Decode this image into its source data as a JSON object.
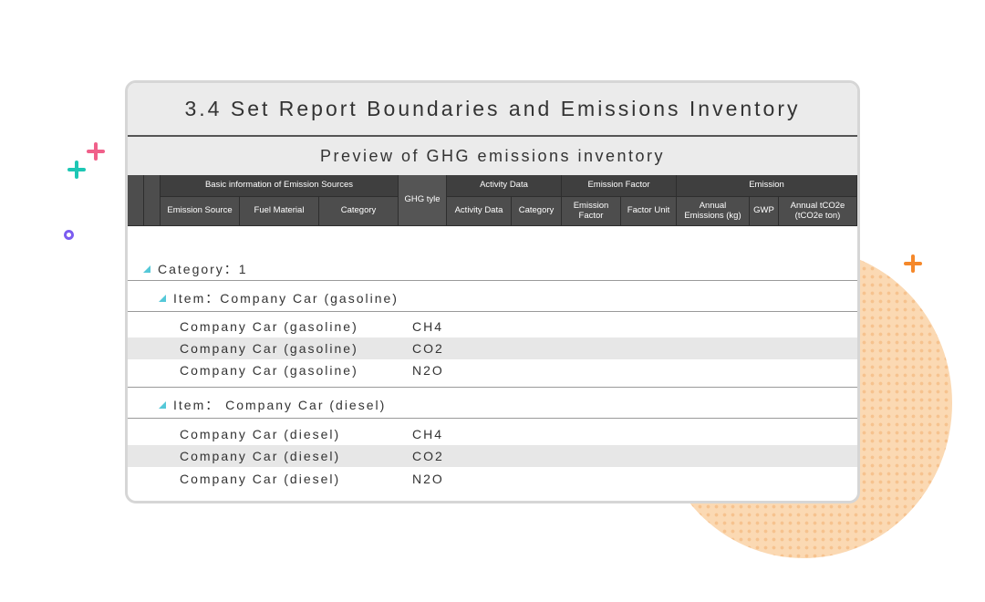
{
  "card": {
    "title": "3.4 Set Report Boundaries and Emissions Inventory",
    "subtitle": "Preview of GHG emissions inventory"
  },
  "header": {
    "groups": {
      "basic_info": "Basic information of Emission Sources",
      "ghg_type": "GHG tyle",
      "activity_data": "Activity Data",
      "emission_factor": "Emission Factor",
      "emission": "Emission"
    },
    "columns": {
      "emission_source": "Emission Source",
      "fuel_material": "Fuel Material",
      "category": "Category",
      "activity_data": "Activity Data",
      "activity_category": "Category",
      "emission_factor": "Emission Factor",
      "factor_unit": "Factor Unit",
      "annual_emissions_kg": "Annual Emissions (kg)",
      "gwp": "GWP",
      "annual_tco2e": "Annual tCO2e (tCO2e ton)"
    }
  },
  "inventory": {
    "category_label": "Category：1",
    "items": [
      {
        "label": "Item：Company Car (gasoline)",
        "rows": [
          {
            "source": "Company Car (gasoline)",
            "ghg": "CH4"
          },
          {
            "source": "Company Car (gasoline)",
            "ghg": "CO2"
          },
          {
            "source": "Company Car (gasoline)",
            "ghg": "N2O"
          }
        ]
      },
      {
        "label": "Item： Company Car  (diesel)",
        "rows": [
          {
            "source": "Company Car (diesel)",
            "ghg": "CH4"
          },
          {
            "source": "Company Car (diesel)",
            "ghg": "CO2"
          },
          {
            "source": "Company Car (diesel)",
            "ghg": "N2O"
          }
        ]
      }
    ]
  },
  "colors": {
    "header_bg": "#444444",
    "triangle_accent": "#54c8d8",
    "row_shade": "#e7e7e7",
    "blob": "#fbd9b3"
  },
  "decorations": [
    "plus-icon-pink",
    "plus-icon-teal",
    "ring-icon-purple",
    "plus-icon-orange",
    "dotted-circle-blob"
  ]
}
